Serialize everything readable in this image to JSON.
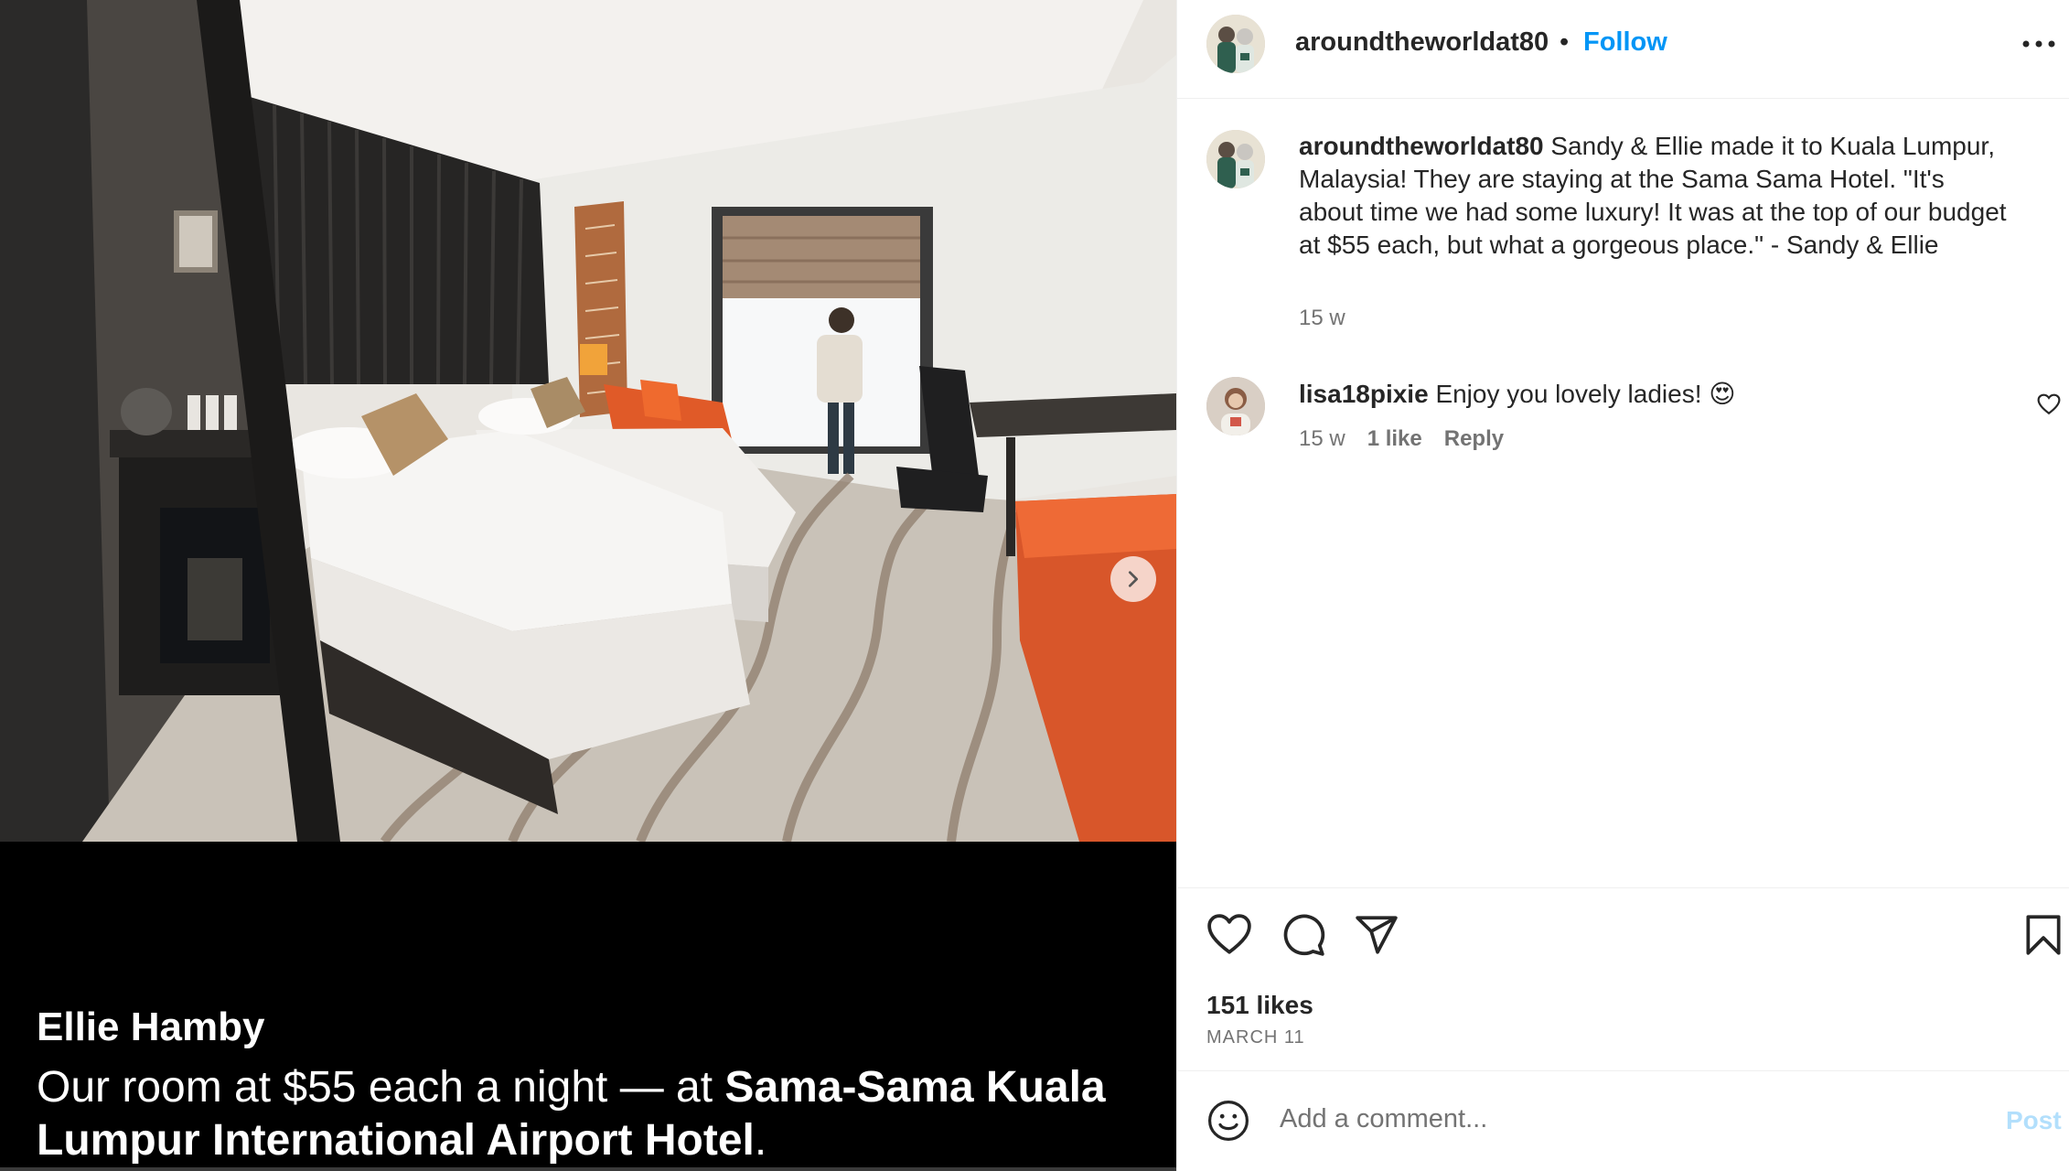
{
  "media": {
    "caption_name": "Ellie Hamby",
    "caption_prefix": "Our room at $55 each a night — at ",
    "caption_bold": "Sama-Sama Kuala Lumpur International Airport Hotel",
    "caption_suffix": ".",
    "next_icon": "chevron-right-icon"
  },
  "header": {
    "username": "aroundtheworldat80",
    "separator": "•",
    "follow_label": "Follow",
    "more_icon": "more-horizontal-icon"
  },
  "caption": {
    "username": "aroundtheworldat80",
    "text": "Sandy & Ellie made it to Kuala Lumpur, Malaysia! They are staying at the Sama Sama Hotel. \"It's about time we had some luxury! It was at the top of our budget at $55 each, but what a gorgeous place.\" - Sandy & Ellie",
    "time": "15 w"
  },
  "comment": {
    "username": "lisa18pixie",
    "text": "Enjoy you lovely ladies! 😍",
    "time": "15 w",
    "likes": "1 like",
    "reply_label": "Reply"
  },
  "actions": {
    "likes": "151 likes",
    "date": "MARCH 11",
    "icons": [
      "heart-icon",
      "comment-icon",
      "share-icon",
      "bookmark-icon"
    ]
  },
  "add_comment": {
    "placeholder": "Add a comment...",
    "post_label": "Post",
    "emoji_icon": "emoji-icon"
  },
  "colors": {
    "link_blue": "#0095f6",
    "post_disabled": "#b2dffc",
    "secondary_text": "#737373"
  }
}
